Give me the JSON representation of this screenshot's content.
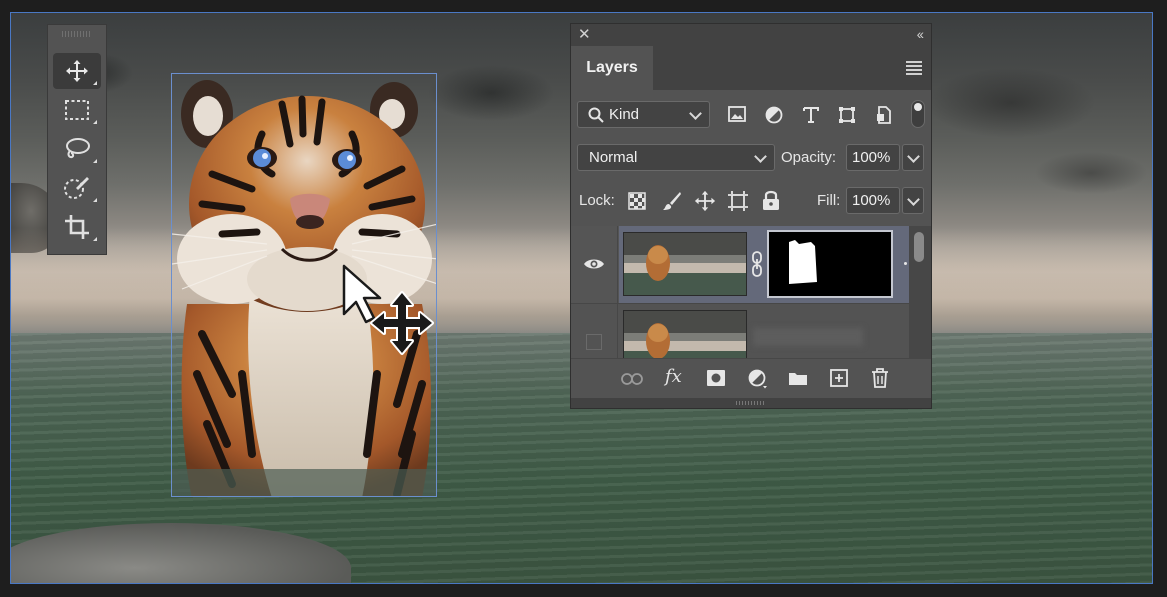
{
  "layers_panel": {
    "close_glyph": "✕",
    "collapse_glyph": "‹‹",
    "tab_label": "Layers",
    "filter_kind_label": "Kind",
    "blend_mode": "Normal",
    "opacity_label": "Opacity:",
    "opacity_value": "100%",
    "lock_label": "Lock:",
    "fill_label": "Fill:",
    "fill_value": "100%",
    "filter_icons": [
      "image-icon",
      "adjustment-icon",
      "type-icon",
      "shape-icon",
      "smart-object-icon"
    ],
    "layers": [
      {
        "visible": true,
        "has_mask": true,
        "selected": true
      },
      {
        "visible": false,
        "has_mask": false,
        "selected": false
      }
    ],
    "footer_icons": [
      "link-icon",
      "fx-icon",
      "mask-icon",
      "adjustment-layer-icon",
      "group-folder-icon",
      "new-layer-icon",
      "trash-icon"
    ],
    "fx_label": "fx"
  },
  "tools_panel": {
    "tools": [
      "move-tool",
      "marquee-tool",
      "lasso-tool",
      "quick-selection-tool",
      "crop-tool"
    ],
    "active_tool": "move-tool"
  },
  "colors": {
    "panel_bg": "#535353",
    "panel_dark": "#424242",
    "selection_border": "#6b8fce",
    "selected_row": "#64697a"
  }
}
